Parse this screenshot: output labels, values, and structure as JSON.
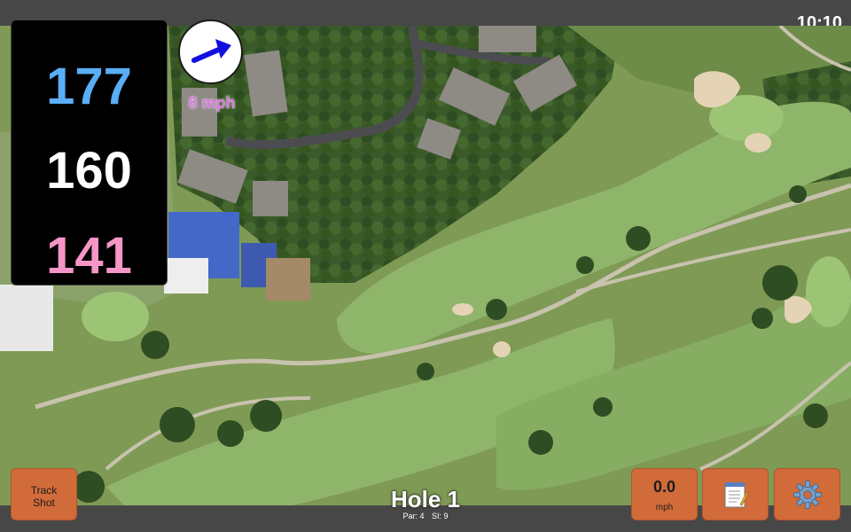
{
  "status_bar": {
    "time": "10:10"
  },
  "distances": {
    "back": "177",
    "middle": "160",
    "front": "141",
    "colors": {
      "back": "#5aaef5",
      "middle": "#ffffff",
      "front": "#f596c6"
    }
  },
  "wind": {
    "speed_label": "8 mph",
    "arrow_icon": "arrow-right-icon"
  },
  "hole": {
    "title": "Hole 1",
    "par": "Par: 4",
    "stroke_index": "SI: 9"
  },
  "buttons": {
    "track_shot": "Track\nShot",
    "speed_value": "0.0",
    "speed_unit": "mph",
    "notes_icon": "notepad-icon",
    "settings_icon": "gear-icon",
    "accent": "#d26b3a"
  }
}
